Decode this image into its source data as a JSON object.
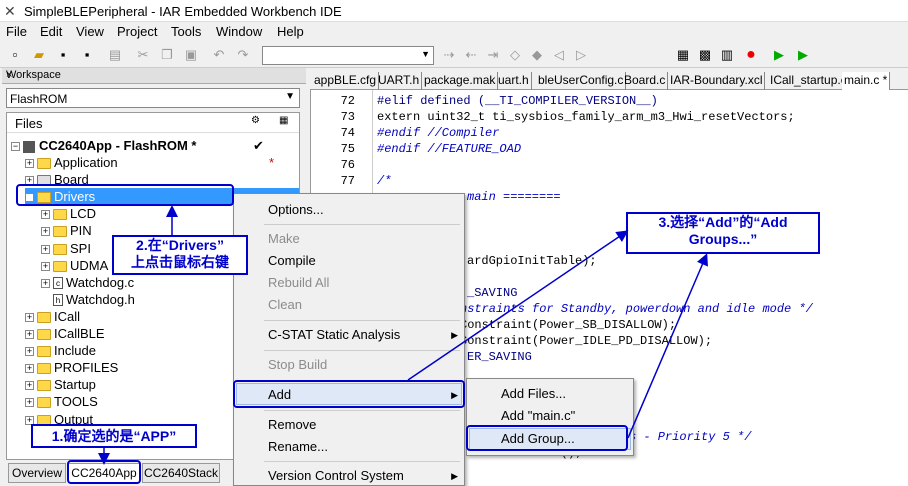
{
  "window": {
    "title": "SimpleBLEPeripheral - IAR Embedded Workbench IDE"
  },
  "menu": [
    "File",
    "Edit",
    "View",
    "Project",
    "Tools",
    "Window",
    "Help"
  ],
  "workspace": {
    "header": "Workspace",
    "close": "×",
    "config": "FlashROM",
    "files_header": "Files",
    "project": "CC2640App - FlashROM *",
    "check": "✔",
    "star": "*",
    "tree": [
      {
        "label": "Application",
        "type": "folder",
        "level": 1,
        "exp": "+"
      },
      {
        "label": "Board",
        "type": "folder-x",
        "level": 1,
        "exp": "+"
      },
      {
        "label": "Drivers",
        "type": "folder",
        "level": 1,
        "exp": "−",
        "selected": true
      },
      {
        "label": "LCD",
        "type": "folder",
        "level": 2,
        "exp": "+"
      },
      {
        "label": "PIN",
        "type": "folder",
        "level": 2,
        "exp": "+"
      },
      {
        "label": "SPI",
        "type": "folder",
        "level": 2,
        "exp": "+"
      },
      {
        "label": "UDMA",
        "type": "folder",
        "level": 2,
        "exp": "+"
      },
      {
        "label": "Watchdog.c",
        "type": "file",
        "level": 2,
        "exp": "+",
        "icon": "c"
      },
      {
        "label": "Watchdog.h",
        "type": "file",
        "level": 2,
        "exp": "",
        "icon": "h"
      },
      {
        "label": "ICall",
        "type": "folder",
        "level": 1,
        "exp": "+"
      },
      {
        "label": "ICallBLE",
        "type": "folder",
        "level": 1,
        "exp": "+"
      },
      {
        "label": "Include",
        "type": "folder",
        "level": 1,
        "exp": "+"
      },
      {
        "label": "PROFILES",
        "type": "folder",
        "level": 1,
        "exp": "+"
      },
      {
        "label": "Startup",
        "type": "folder",
        "level": 1,
        "exp": "+"
      },
      {
        "label": "TOOLS",
        "type": "folder",
        "level": 1,
        "exp": "+"
      },
      {
        "label": "Output",
        "type": "folder",
        "level": 1,
        "exp": "+"
      }
    ],
    "tabs": [
      "Overview",
      "CC2640App",
      "CC2640Stack"
    ]
  },
  "editor": {
    "tabs": [
      "appBLE.cfg",
      "UART.h",
      "package.mak",
      "uart.h",
      "bleUserConfig.c",
      "Board.c",
      "IAR-Boundary.xcl",
      "ICall_startup.c",
      "main.c *"
    ],
    "lines": [
      {
        "n": "72",
        "code": "#elif defined (__TI_COMPILER_VERSION__)"
      },
      {
        "n": "73",
        "code": "extern uint32_t ti_sysbios_family_arm_m3_Hwi_resetVectors;"
      },
      {
        "n": "74",
        "code": "#endif //Compiler"
      },
      {
        "n": "75",
        "code": "#endif //FEATURE_OAD"
      },
      {
        "n": "76",
        "code": ""
      },
      {
        "n": "77",
        "code": "/*"
      }
    ],
    "visible_fragments": [
      "main ========",
      "ardGpioInitTable);",
      "_SAVING",
      "nstraints for Standby, powerdown and idle mode */",
      "Constraint(Power_SB_DISALLOW);",
      "Constraint(Power_IDLE_PD_DISALLOW);",
      "ER_SAVING",
      "s - Priority 5 */",
      "teRemoteTasks();"
    ]
  },
  "context_menu": {
    "items": [
      {
        "label": "Options...",
        "disabled": false
      },
      {
        "label": "Make",
        "disabled": true
      },
      {
        "label": "Compile",
        "disabled": false
      },
      {
        "label": "Rebuild All",
        "disabled": true
      },
      {
        "label": "Clean",
        "disabled": true
      },
      {
        "label": "C-STAT Static Analysis",
        "disabled": false,
        "submenu": true
      },
      {
        "label": "Stop Build",
        "disabled": true
      },
      {
        "label": "Add",
        "disabled": false,
        "submenu": true
      },
      {
        "label": "Remove",
        "disabled": false
      },
      {
        "label": "Rename...",
        "disabled": false
      },
      {
        "label": "Version Control System",
        "disabled": false,
        "submenu": true
      }
    ],
    "submenu": [
      "Add Files...",
      "Add \"main.c\"",
      "Add Group..."
    ]
  },
  "annotations": {
    "step1": "1.确定选的是“APP”",
    "step2_line1": "2.在“Drivers”",
    "step2_line2": "上点击鼠标右键",
    "step3_line1": "3.选择“Add”的“Add",
    "step3_line2": "Groups...”"
  },
  "colors": {
    "annotation": "#0000cc",
    "selection": "#3399ff",
    "folder": "#ffd84a"
  }
}
